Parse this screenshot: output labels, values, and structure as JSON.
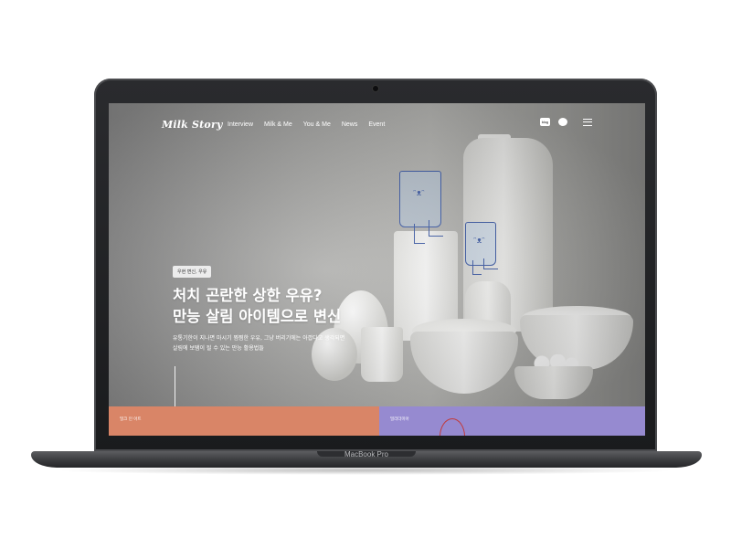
{
  "device": {
    "model_label": "MacBook Pro"
  },
  "site": {
    "logo": "Milk Story",
    "nav": {
      "items": [
        {
          "label": "Interview"
        },
        {
          "label": "Milk & Me"
        },
        {
          "label": "You & Me"
        },
        {
          "label": "News"
        },
        {
          "label": "Event"
        }
      ],
      "icons": [
        "blog-icon",
        "talk-icon",
        "hamburger-menu-icon"
      ],
      "blog_icon_text": "blog"
    },
    "hero": {
      "tag": "우현 변신, 우유",
      "headline_line1": "처치 곤란한 상한 우유?",
      "headline_line2": "만능 살림 아이템으로 변신",
      "desc_line1": "유통기한이 지나면 마시기 찜찜한 우유, 그냥 버리기에는 아깝다고 생각되면",
      "desc_line2": "살림에 보탬이 될 수 있는 만능 활용법들"
    },
    "panels": {
      "left": {
        "label": "밀크 인 아트",
        "color": "#d98567"
      },
      "right": {
        "label": "밀리더미아",
        "color": "#968ad0"
      }
    }
  }
}
